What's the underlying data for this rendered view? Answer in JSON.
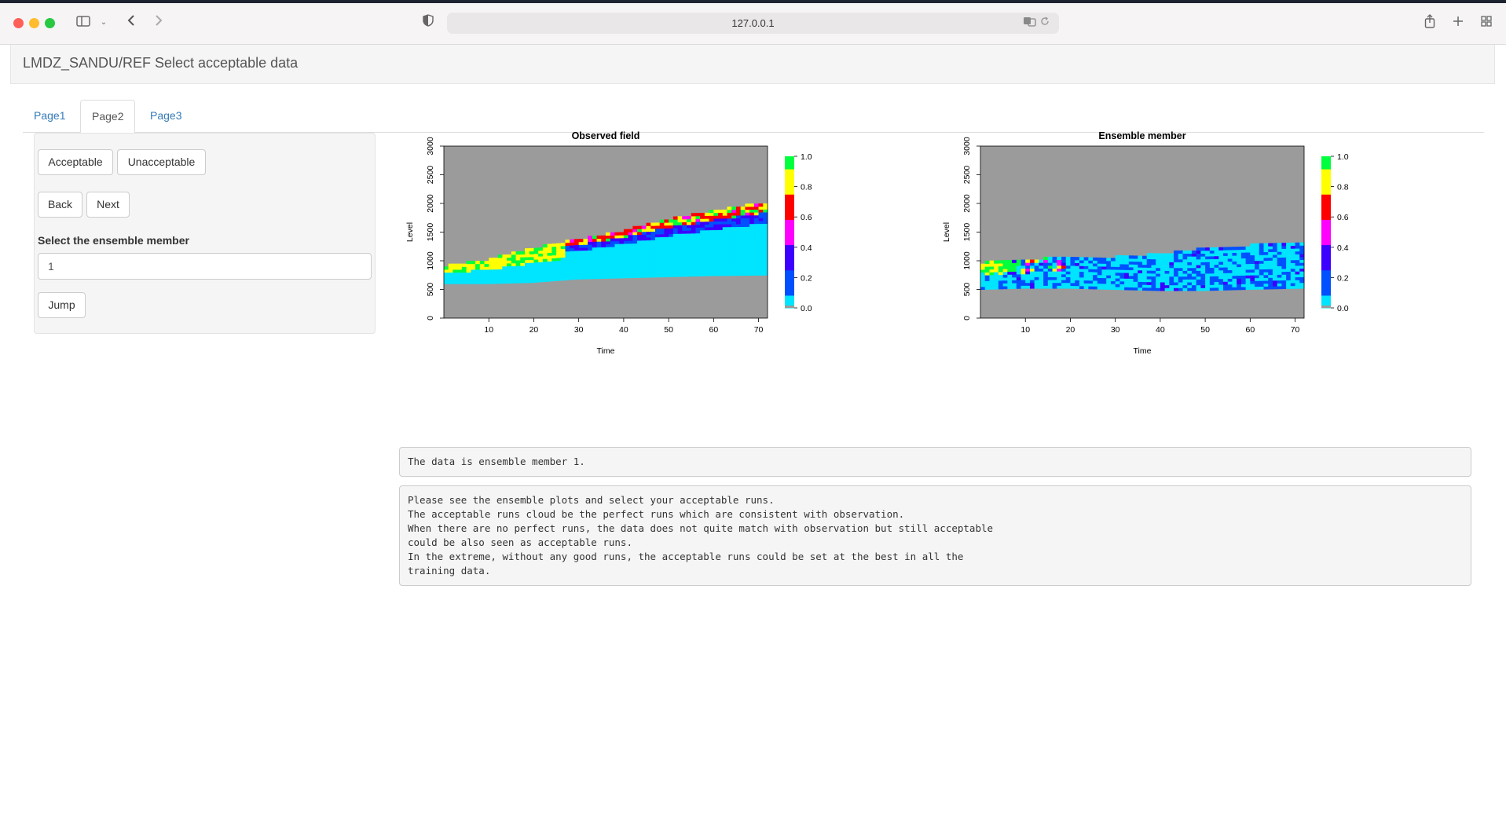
{
  "browser": {
    "url": "127.0.0.1",
    "icons": [
      "sidebar-icon",
      "chevron-down-icon",
      "back-arrow-icon",
      "forward-arrow-icon",
      "shield-icon",
      "translate-icon",
      "reload-icon",
      "share-icon",
      "new-tab-icon",
      "tab-overview-icon"
    ]
  },
  "app": {
    "title": "LMDZ_SANDU/REF Select acceptable data"
  },
  "tabs": [
    {
      "label": "Page1",
      "active": false
    },
    {
      "label": "Page2",
      "active": true
    },
    {
      "label": "Page3",
      "active": false
    }
  ],
  "sidebar": {
    "acceptable_label": "Acceptable",
    "unacceptable_label": "Unacceptable",
    "back_label": "Back",
    "next_label": "Next",
    "member_label": "Select the ensemble member",
    "member_value": "1",
    "jump_label": "Jump"
  },
  "colors": {
    "plot_background": "#9b9b9b",
    "colorscale": [
      "#00e5ff",
      "#0050ff",
      "#3c00ff",
      "#ff00ff",
      "#ff0000",
      "#ffff00",
      "#00ff3c"
    ]
  },
  "chart_data": [
    {
      "type": "heatmap",
      "title": "Observed field",
      "xlabel": "Time",
      "ylabel": "Level",
      "x_ticks": [
        10,
        20,
        30,
        40,
        50,
        60,
        70
      ],
      "y_ticks": [
        0,
        500,
        1000,
        1500,
        2000,
        2500,
        3000
      ],
      "xlim": [
        0,
        72
      ],
      "ylim": [
        0,
        3000
      ],
      "colorbar_ticks": [
        "0.0",
        "0.2",
        "0.4",
        "0.6",
        "0.8",
        "1.0"
      ],
      "colorbar_range": [
        0,
        1
      ],
      "cloud_base": [
        [
          1,
          600
        ],
        [
          10,
          600
        ],
        [
          20,
          620
        ],
        [
          30,
          680
        ],
        [
          40,
          700
        ],
        [
          50,
          720
        ],
        [
          60,
          740
        ],
        [
          72,
          750
        ]
      ],
      "cloud_top": [
        [
          1,
          900
        ],
        [
          10,
          1000
        ],
        [
          20,
          1200
        ],
        [
          30,
          1350
        ],
        [
          40,
          1500
        ],
        [
          50,
          1700
        ],
        [
          60,
          1850
        ],
        [
          72,
          2000
        ]
      ],
      "high_value_band": "near cloud top, ~0.8-1.0"
    },
    {
      "type": "heatmap",
      "title": "Ensemble member",
      "xlabel": "Time",
      "ylabel": "Level",
      "x_ticks": [
        10,
        20,
        30,
        40,
        50,
        60,
        70
      ],
      "y_ticks": [
        0,
        500,
        1000,
        1500,
        2000,
        2500,
        3000
      ],
      "xlim": [
        0,
        72
      ],
      "ylim": [
        0,
        3000
      ],
      "colorbar_ticks": [
        "0.0",
        "0.2",
        "0.4",
        "0.6",
        "0.8",
        "1.0"
      ],
      "colorbar_range": [
        0,
        1
      ],
      "cloud_base": [
        [
          1,
          500
        ],
        [
          10,
          520
        ],
        [
          20,
          520
        ],
        [
          30,
          500
        ],
        [
          40,
          480
        ],
        [
          50,
          480
        ],
        [
          60,
          500
        ],
        [
          72,
          520
        ]
      ],
      "cloud_top": [
        [
          1,
          950
        ],
        [
          10,
          1000
        ],
        [
          20,
          1050
        ],
        [
          30,
          1050
        ],
        [
          40,
          1100
        ],
        [
          50,
          1200
        ],
        [
          60,
          1250
        ],
        [
          72,
          1300
        ]
      ],
      "high_value_band": "early times t<20, ~0.5-1.0"
    }
  ],
  "output1": "The data is ensemble member 1.",
  "output2": "Please see the ensemble plots and select your acceptable runs.\nThe acceptable runs cloud be the perfect runs which are consistent with observation.\nWhen there are no perfect runs, the data does not quite match with observation but still acceptable\ncould be also seen as acceptable runs.\nIn the extreme, without any good runs, the acceptable runs could be set at the best in all the\ntraining data."
}
